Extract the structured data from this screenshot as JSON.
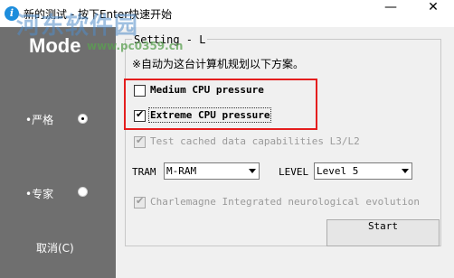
{
  "window": {
    "title": "新的测试 - 按下Enter快速开始",
    "minimize_glyph": "—",
    "close_glyph": "✕",
    "app_icon_glyph": "i"
  },
  "watermark": {
    "text": "河东软件园",
    "url": "www.pc0359.cn"
  },
  "sidebar": {
    "title": "Mode",
    "items": [
      {
        "label": "•严格",
        "selected": true
      },
      {
        "label": "•专家",
        "selected": false
      }
    ],
    "cancel_label": "取消(C)"
  },
  "settings": {
    "group_label": "Setting - L",
    "hint": "※自动为这台计算机规划以下方案。",
    "options": [
      {
        "label": "Medium CPU pressure",
        "checked": false,
        "enabled": true
      },
      {
        "label": "Extreme CPU pressure",
        "checked": true,
        "enabled": true
      },
      {
        "label": "Test cached data capabilities L3/L2",
        "checked": true,
        "enabled": false
      },
      {
        "label": "Charlemagne Integrated neurological evolution",
        "checked": true,
        "enabled": false
      }
    ],
    "tram_label": "TRAM",
    "tram_value": "M-RAM",
    "level_label": "LEVEL",
    "level_value": "Level 5",
    "start_label": "Start"
  },
  "colors": {
    "sidebar_bg": "#6f6f6f",
    "highlight_box": "#e41e1e",
    "panel_bg": "#f0f0f0"
  }
}
